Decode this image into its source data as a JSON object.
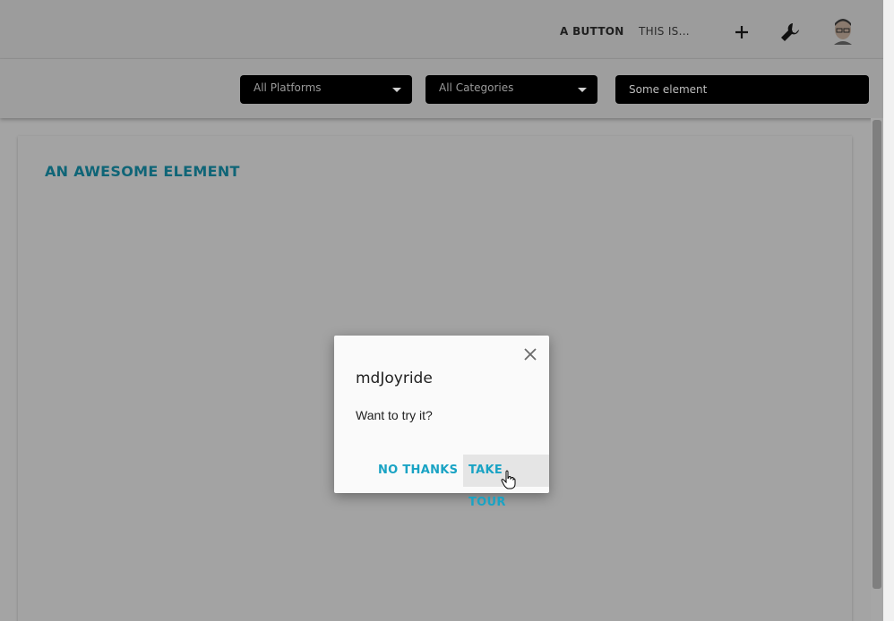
{
  "header": {
    "primary_button": "A BUTTON",
    "secondary_button": "THIS IS...",
    "icons": [
      "plus-icon",
      "wrench-icon",
      "avatar"
    ]
  },
  "filters": {
    "platform": "All Platforms",
    "category": "All Categories",
    "search_placeholder": "Some element"
  },
  "card": {
    "title": "AN AWESOME ELEMENT"
  },
  "dialog": {
    "title": "mdJoyride",
    "text": "Want to try it?",
    "no_thanks": "NO THANKS",
    "take_tour": "TAKE TOUR"
  },
  "colors": {
    "accent": "#19a3c4",
    "title": "#0f6577",
    "overlay": "#a4a4a4"
  }
}
